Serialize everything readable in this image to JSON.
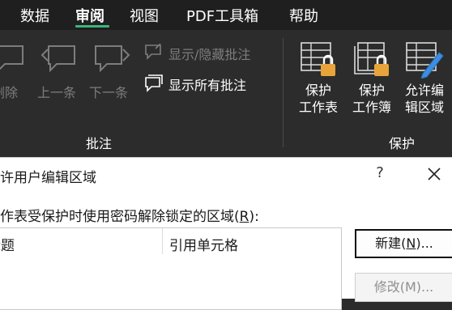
{
  "tabs": [
    "数据",
    "审阅",
    "视图",
    "PDF工具箱",
    "帮助"
  ],
  "active_tab": "审阅",
  "accent_color": "#3fb37f",
  "ribbon": {
    "comments_group": {
      "label": "批注",
      "delete_label": "删除",
      "prev_label": "上一条",
      "next_label": "下一条",
      "show_hide_label": "显示/隐藏批注",
      "show_all_label": "显示所有批注"
    },
    "protect_group": {
      "label": "保护",
      "protect_sheet": [
        "保护",
        "工作表"
      ],
      "protect_workbook": [
        "保护",
        "工作簿"
      ],
      "allow_edit_ranges": [
        "允许编",
        "辑区域"
      ]
    }
  },
  "dialog": {
    "title": "允许用户编辑区域",
    "help": "?",
    "description": "工作表受保护时使用密码解除锁定的区域(",
    "description_key": "R",
    "description_end": "):",
    "columns": [
      "标题",
      "引用单元格"
    ],
    "new_button": {
      "label": "新建(",
      "key": "N",
      "end": ")..."
    },
    "modify_button": {
      "label": "修改(M)..."
    }
  }
}
